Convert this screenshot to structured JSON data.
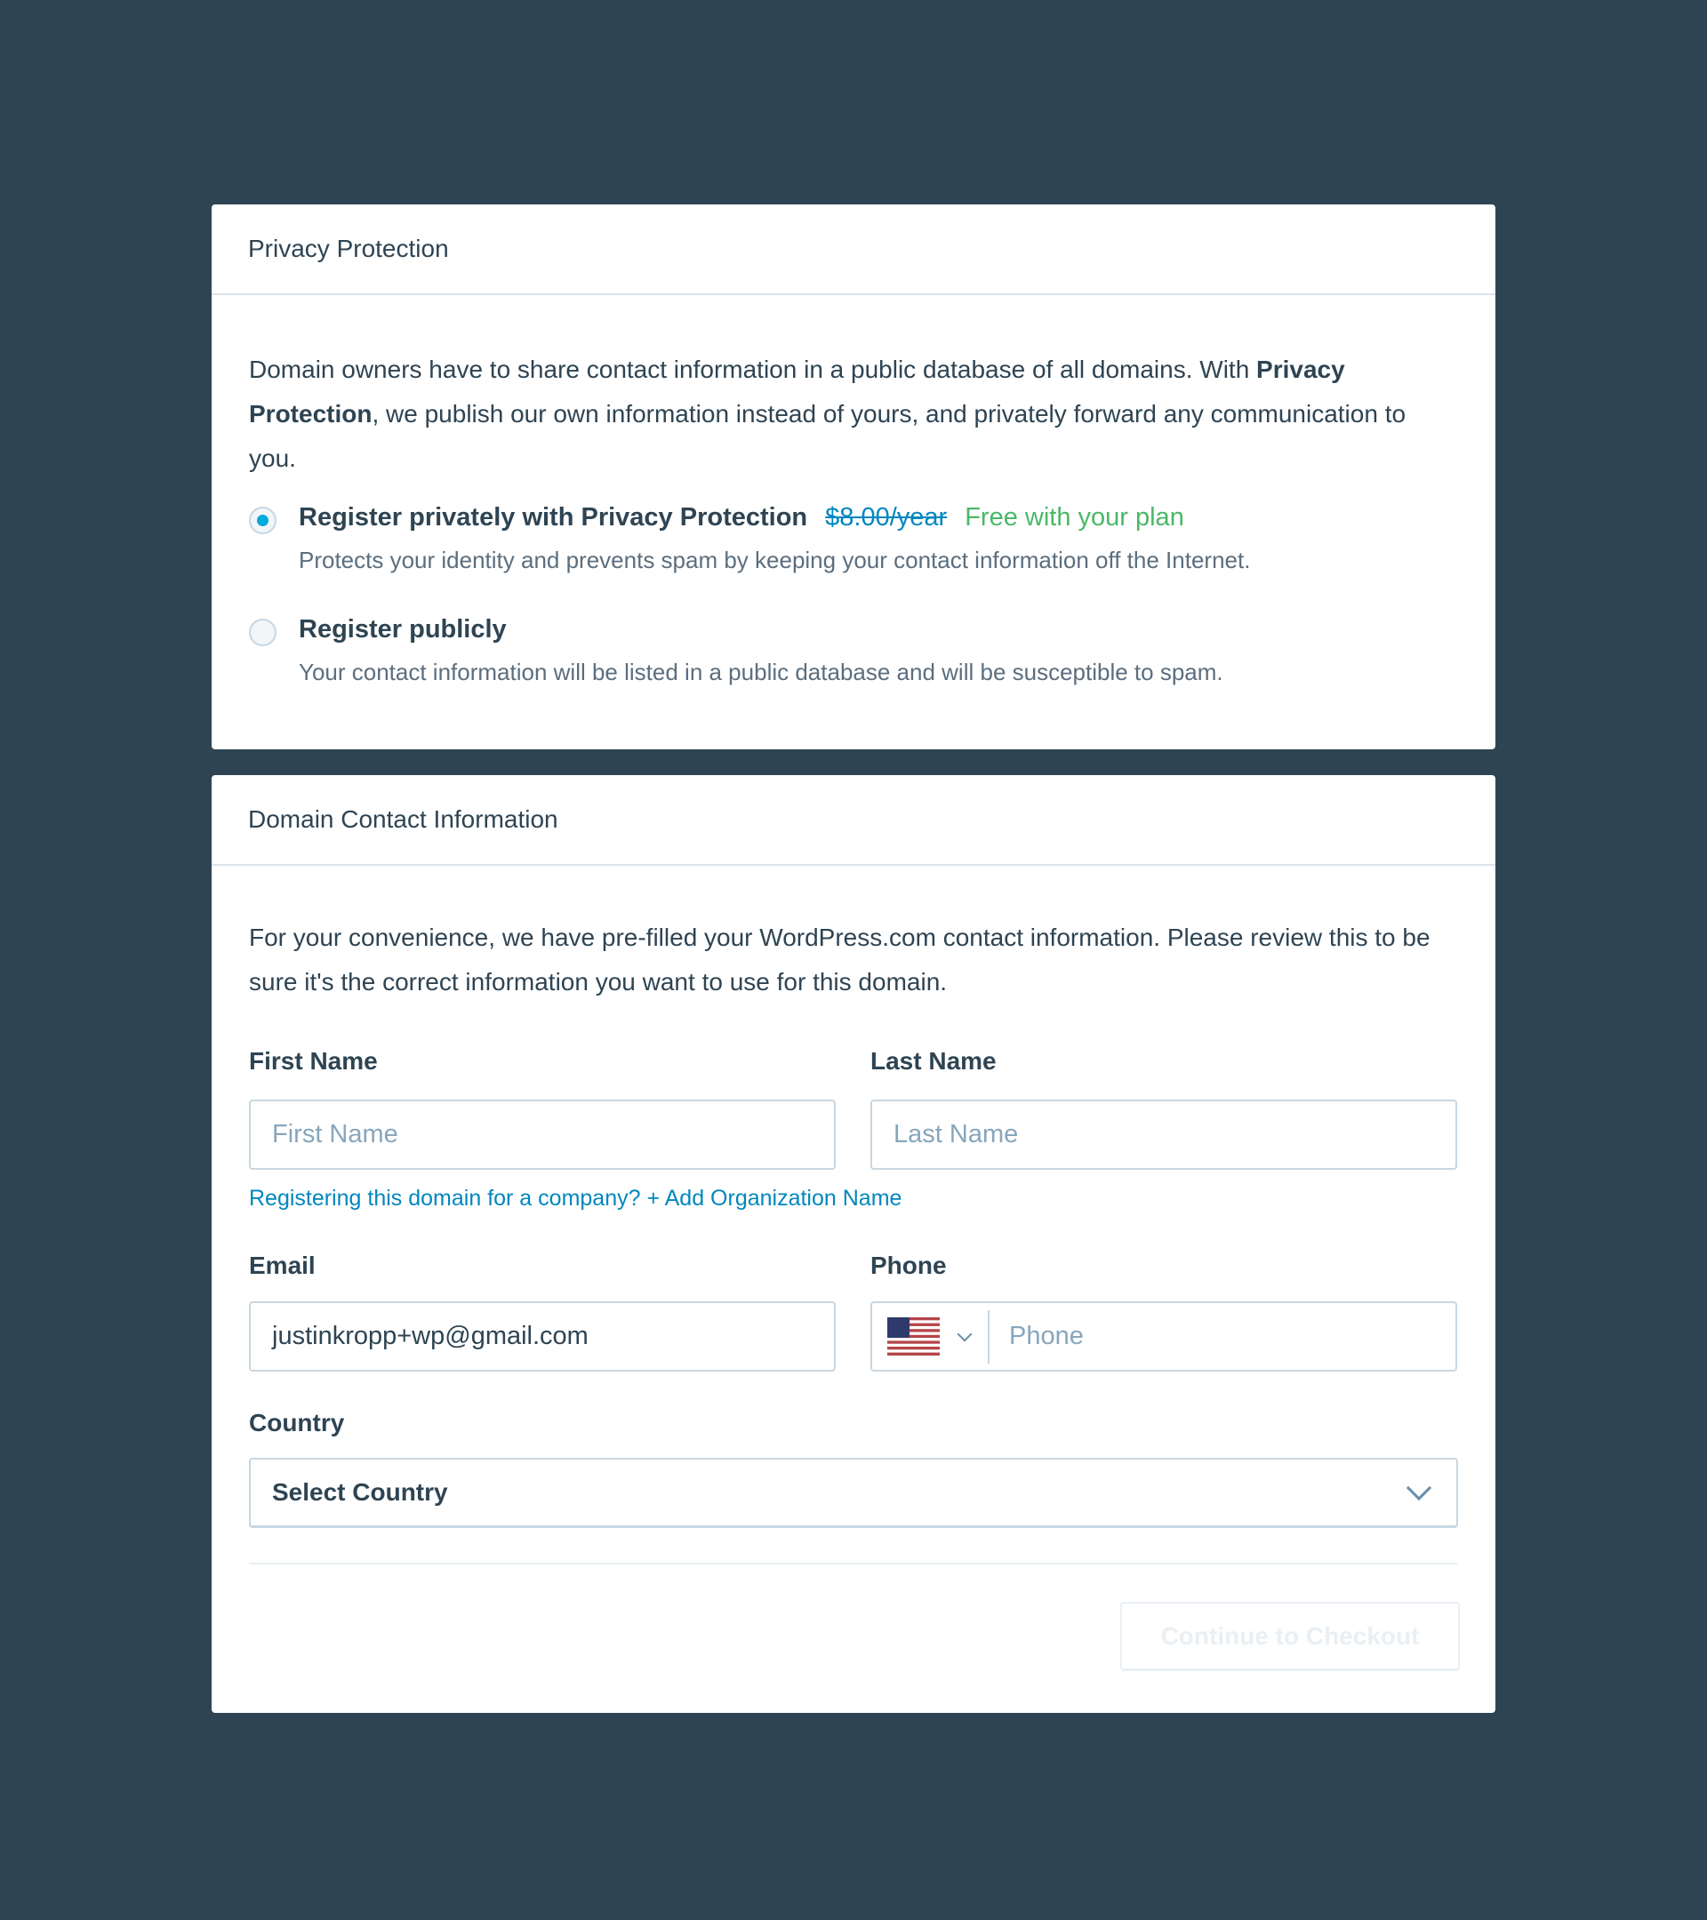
{
  "privacy": {
    "title": "Privacy Protection",
    "intro_1": "Domain owners have to share contact information in a public database of all domains. With ",
    "intro_bold": "Privacy Protection",
    "intro_2": ", we publish our own information instead of yours, and privately forward any communication to you.",
    "options": [
      {
        "label": "Register privately with Privacy Protection",
        "old_price": "$8.00/year",
        "promo": "Free with your plan",
        "desc": "Protects your identity and prevents spam by keeping your contact information off the Internet.",
        "selected": true
      },
      {
        "label": "Register publicly",
        "desc": "Your contact information will be listed in a public database and will be susceptible to spam.",
        "selected": false
      }
    ]
  },
  "contact": {
    "title": "Domain Contact Information",
    "intro": "For your convenience, we have pre-filled your WordPress.com contact information. Please review this to be sure it's the correct information you want to use for this domain.",
    "first_name": {
      "label": "First Name",
      "placeholder": "First Name",
      "value": ""
    },
    "last_name": {
      "label": "Last Name",
      "placeholder": "Last Name",
      "value": ""
    },
    "org_link": "Registering this domain for a company? + Add Organization Name",
    "email": {
      "label": "Email",
      "value": "justinkropp+wp@gmail.com"
    },
    "phone": {
      "label": "Phone",
      "placeholder": "Phone",
      "country_flag": "us-flag-icon"
    },
    "country": {
      "label": "Country",
      "value": "Select Country"
    },
    "submit": "Continue to Checkout"
  },
  "colors": {
    "background": "#2e4453",
    "accent": "#00aadc",
    "link": "#0087be",
    "success": "#4ab866"
  }
}
